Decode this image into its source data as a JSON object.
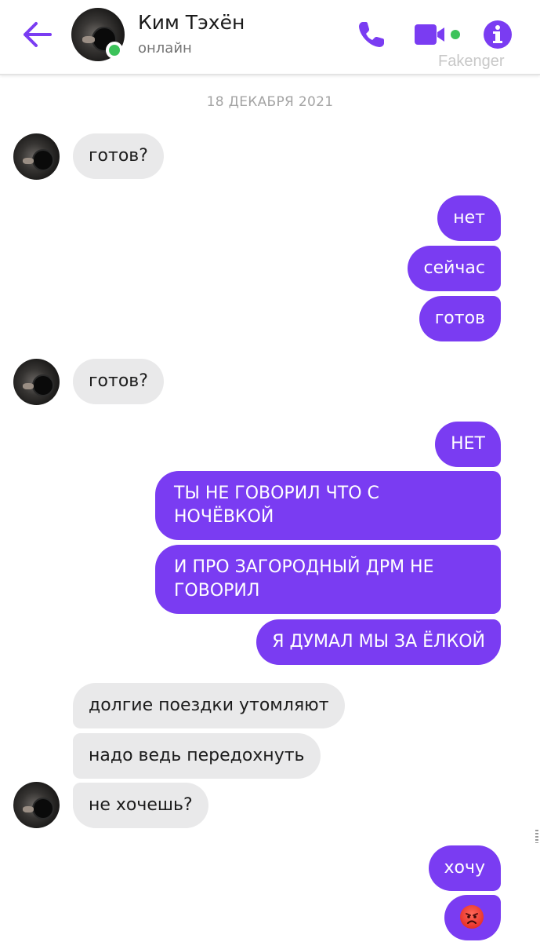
{
  "header": {
    "contact_name": "Ким Тэхён",
    "status": "онлайн",
    "watermark": "Fakenger",
    "icons": {
      "back": "arrow-left-icon",
      "call": "phone-icon",
      "video": "video-camera-icon",
      "info": "info-icon"
    },
    "accent_color": "#7a3cf2",
    "online_color": "#3cc35a"
  },
  "chat": {
    "date": "18 ДЕКАБРЯ 2021",
    "messages": [
      {
        "from": "contact",
        "text": "готов?"
      },
      {
        "from": "me",
        "text": "нет"
      },
      {
        "from": "me",
        "text": "сейчас"
      },
      {
        "from": "me",
        "text": "готов"
      },
      {
        "from": "contact",
        "text": "готов?"
      },
      {
        "from": "me",
        "text": "НЕТ"
      },
      {
        "from": "me",
        "text": "ТЫ НЕ ГОВОРИЛ ЧТО С НОЧЁВКОЙ"
      },
      {
        "from": "me",
        "text": "И ПРО ЗАГОРОДНЫЙ ДРМ НЕ ГОВОРИЛ"
      },
      {
        "from": "me",
        "text": "Я ДУМАЛ МЫ ЗА ЁЛКОЙ"
      },
      {
        "from": "contact",
        "text": "долгие поездки утомляют"
      },
      {
        "from": "contact",
        "text": "надо ведь передохнуть"
      },
      {
        "from": "contact",
        "text": "не хочешь?"
      },
      {
        "from": "me",
        "text": "хочу"
      },
      {
        "from": "me",
        "emoji": "angry-face-icon"
      }
    ],
    "incoming_bubble_color": "#e9e9ea",
    "outgoing_bubble_color": "#7a3cf2"
  }
}
